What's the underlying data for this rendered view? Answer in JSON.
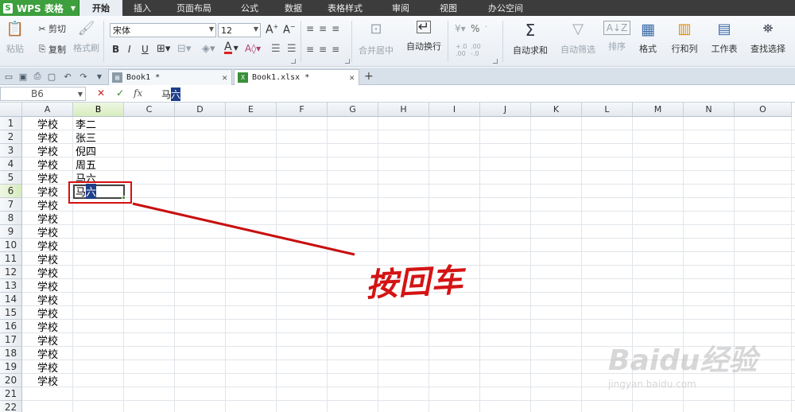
{
  "app": {
    "name": "WPS 表格",
    "logo_letter": "S"
  },
  "menu": [
    "开始",
    "插入",
    "页面布局",
    "公式",
    "数据",
    "表格样式",
    "审阅",
    "视图",
    "办公空间"
  ],
  "ribbon": {
    "paste": "粘贴",
    "cut": "剪切",
    "copy": "复制",
    "format_painter": "格式刷",
    "font_name": "宋体",
    "font_size": "12",
    "bold": "B",
    "italic": "I",
    "underline": "U",
    "merge_center": "合并居中",
    "wrap_text": "自动换行",
    "percent": "%",
    "autosum": "自动求和",
    "autofilter": "自动筛选",
    "sort": "排序",
    "format": "格式",
    "rows_cols": "行和列",
    "worksheet": "工作表",
    "find_select": "查找选择"
  },
  "tabs": [
    {
      "name": "Book1 *",
      "active": false
    },
    {
      "name": "Book1.xlsx *",
      "active": true
    }
  ],
  "formula_bar": {
    "cell_ref": "B6",
    "fx": "fx",
    "value_prefix": "马",
    "value_highlight": "六"
  },
  "columns": [
    "A",
    "B",
    "C",
    "D",
    "E",
    "F",
    "G",
    "H",
    "I",
    "J",
    "K",
    "L",
    "M",
    "N",
    "O"
  ],
  "rows": [
    "1",
    "2",
    "3",
    "4",
    "5",
    "6",
    "7",
    "8",
    "9",
    "10",
    "11",
    "12",
    "13",
    "14",
    "15",
    "16",
    "17",
    "18",
    "19",
    "20",
    "21",
    "22"
  ],
  "column_a": [
    "学校",
    "学校",
    "学校",
    "学校",
    "学校",
    "学校",
    "学校",
    "学校",
    "学校",
    "学校",
    "学校",
    "学校",
    "学校",
    "学校",
    "学校",
    "学校",
    "学校",
    "学校",
    "学校",
    "学校"
  ],
  "column_b": [
    "李二",
    "张三",
    "倪四",
    "周五",
    "马六"
  ],
  "editing_cell": {
    "prefix": "马",
    "highlight": "六"
  },
  "annotation": "按回车",
  "watermark": {
    "brand": "Baidu经验",
    "url": "jingyan.baidu.com"
  },
  "colors": {
    "accent_green": "#3d9f3d",
    "annotation_red": "#d41414",
    "selection_green": "#d7ecbf"
  }
}
